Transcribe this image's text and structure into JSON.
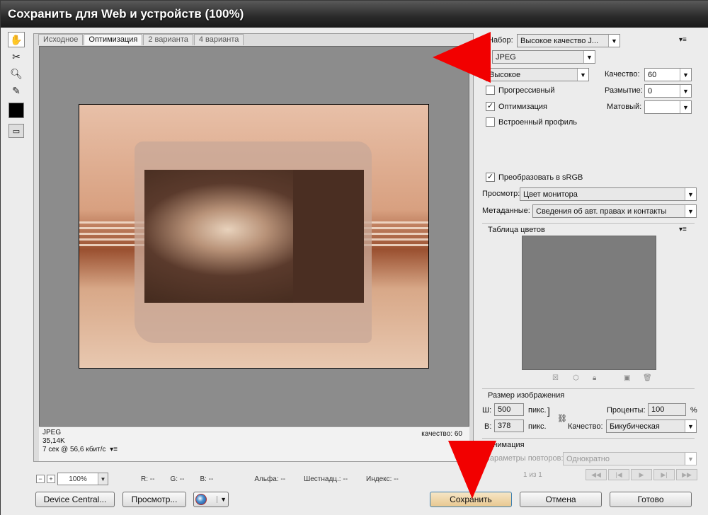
{
  "window": {
    "title": "Сохранить для Web и устройств (100%)"
  },
  "tabs": [
    "Исходное",
    "Оптимизация",
    "2 варианта",
    "4 варианта"
  ],
  "canvas_info": {
    "format": "JPEG",
    "size": "35,14K",
    "speed": "7 сек @ 56,6 кбит/с",
    "quality": "качество: 60"
  },
  "status": {
    "zoom": "100%",
    "r": "R: --",
    "g": "G: --",
    "b": "B: --",
    "alpha": "Альфа: --",
    "hex": "Шестнадц.: --",
    "index": "Индекс: --"
  },
  "buttons": {
    "device_central": "Device Central...",
    "preview": "Просмотр...",
    "save": "Сохранить",
    "cancel": "Отмена",
    "done": "Готово"
  },
  "settings": {
    "preset_label": "Набор:",
    "preset_value": "Высокое качество J...",
    "format_value": "JPEG",
    "quality_preset": "Высокое",
    "quality_label": "Качество:",
    "quality_value": "60",
    "blur_label": "Размытие:",
    "blur_value": "0",
    "matte_label": "Матовый:",
    "matte_value": "",
    "progressive": "Прогрессивный",
    "optimized": "Оптимизация",
    "embed_profile": "Встроенный профиль",
    "convert_srgb": "Преобразовать в sRGB",
    "preview_label": "Просмотр:",
    "preview_value": "Цвет монитора",
    "metadata_label": "Метаданные:",
    "metadata_value": "Сведения об авт. правах и контакты",
    "color_table": "Таблица цветов"
  },
  "image_size": {
    "title": "Размер изображения",
    "w_label": "Ш:",
    "w_value": "500",
    "h_label": "В:",
    "h_value": "378",
    "unit": "пикс.",
    "percent_label": "Проценты:",
    "percent_value": "100",
    "percent_sign": "%",
    "quality_label": "Качество:",
    "quality_value": "Бикубическая"
  },
  "animation": {
    "title": "Анимация",
    "loop_label": "Параметры повторов:",
    "loop_value": "Однократно",
    "frame": "1 из 1"
  }
}
